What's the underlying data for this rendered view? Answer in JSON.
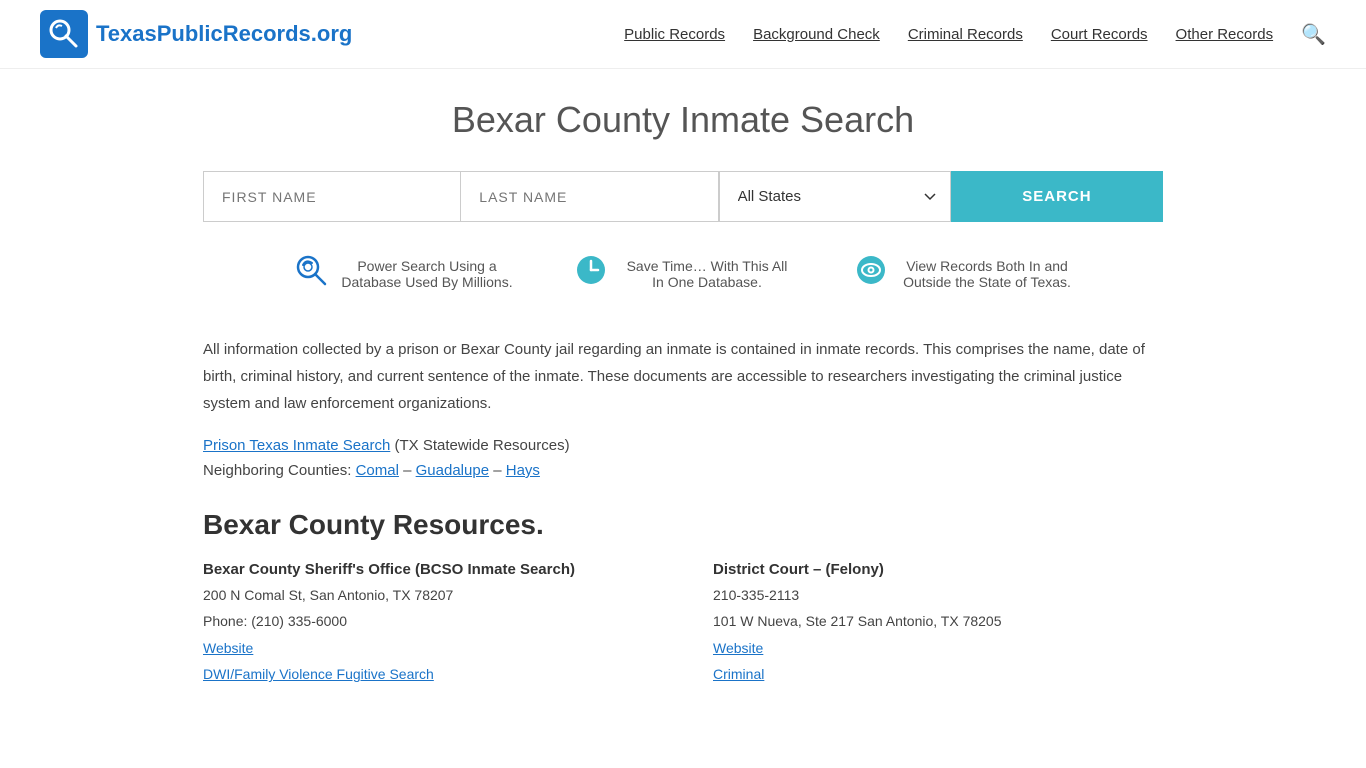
{
  "site": {
    "logo_text": "TexasPublicRecords.org",
    "logo_icon_bg": "#1a73c8"
  },
  "nav": {
    "items": [
      {
        "label": "Public Records",
        "id": "public-records"
      },
      {
        "label": "Background Check",
        "id": "background-check"
      },
      {
        "label": "Criminal Records",
        "id": "criminal-records"
      },
      {
        "label": "Court Records",
        "id": "court-records"
      },
      {
        "label": "Other Records",
        "id": "other-records"
      }
    ]
  },
  "page": {
    "title": "Bexar County Inmate Search"
  },
  "search": {
    "first_name_placeholder": "FIRST NAME",
    "last_name_placeholder": "LAST NAME",
    "state_default": "All States",
    "button_label": "SEARCH"
  },
  "features": [
    {
      "id": "power-search",
      "icon": "🔍",
      "icon_color": "#1a73c8",
      "text": "Power Search Using a Database Used By Millions."
    },
    {
      "id": "save-time",
      "icon": "🕐",
      "icon_color": "#3bb8c8",
      "text": "Save Time… With This All In One Database."
    },
    {
      "id": "view-records",
      "icon": "👁",
      "icon_color": "#3bb8c8",
      "text": "View Records Both In and Outside the State of Texas."
    }
  ],
  "description": "All information collected by a prison or Bexar County jail regarding an inmate is contained in inmate records. This comprises the name, date of birth, criminal history, and current sentence of the inmate. These documents are accessible to researchers investigating the criminal justice system and law enforcement organizations.",
  "links": {
    "prison_search_label": "Prison Texas Inmate Search",
    "prison_search_suffix": " (TX Statewide Resources)",
    "neighboring_label": "Neighboring Counties: ",
    "counties": [
      {
        "label": "Comal",
        "href": "#"
      },
      {
        "label": "Guadalupe",
        "href": "#"
      },
      {
        "label": "Hays",
        "href": "#"
      }
    ]
  },
  "resources": {
    "title": "Bexar County Resources.",
    "left": [
      {
        "id": "sheriffs-office",
        "heading": "Bexar County Sheriff's Office (BCSO Inmate Search)",
        "address": "200 N Comal St, San Antonio, TX 78207",
        "phone": "Phone: (210) 335-6000",
        "link1_label": "Website",
        "link2_label": "DWI/Family Violence Fugitive Search"
      }
    ],
    "right": [
      {
        "id": "district-court",
        "heading": "District Court – (Felony)",
        "phone": "210-335-2113",
        "address": "101 W Nueva, Ste 217 San Antonio, TX 78205",
        "link1_label": "Website",
        "link2_label": "Criminal"
      }
    ]
  }
}
